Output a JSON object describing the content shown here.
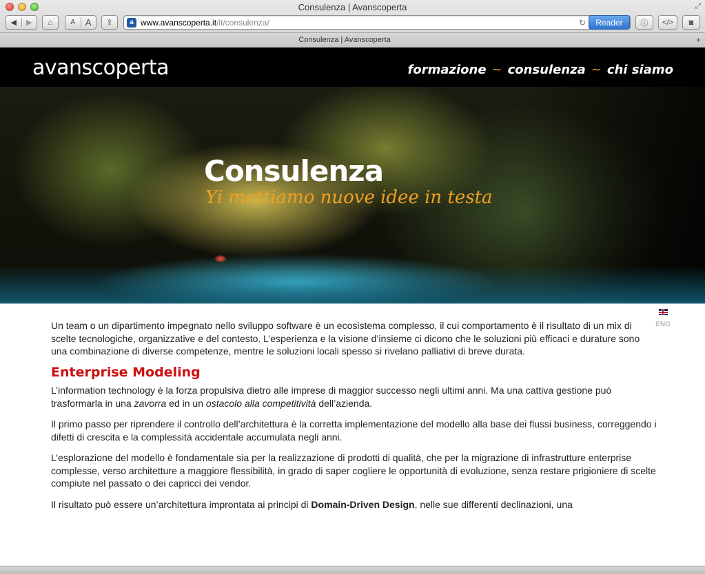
{
  "window": {
    "title": "Consulenza | Avanscoperta"
  },
  "toolbar": {
    "back_icon": "chevron-left",
    "forward_icon": "chevron-right",
    "home_icon": "home",
    "font_small": "A",
    "font_large": "A",
    "share_icon": "share",
    "url_host": "www.avanscoperta.it",
    "url_path": "/it/consulenza/",
    "reader_label": "Reader"
  },
  "tab": {
    "title": "Consulenza | Avanscoperta"
  },
  "site": {
    "logo": "avanscoperta",
    "nav": {
      "formazione": "formazione",
      "consulenza": "consulenza",
      "chi_siamo": "chi siamo",
      "separator": "~"
    },
    "hero": {
      "title": "Consulenza",
      "subtitle": "Yi mettiamo nuove idee in testa"
    },
    "lang_label": "ENG"
  },
  "content": {
    "intro": "Un team o un dipartimento impegnato nello sviluppo software è un ecosistema complesso, il cui comportamento è il risultato di un mix di scelte tecnologiche, organizzative e del contesto. L’esperienza e la visione d’insieme ci dicono che le soluzioni più efficaci e durature sono una combinazione di diverse competenze, mentre le soluzioni locali spesso si rivelano palliativi di breve durata.",
    "heading": "Enterprise Modeling",
    "p1_a": "L’information technology è la forza propulsiva dietro alle imprese di maggior successo negli ultimi anni. Ma una cattiva gestione può trasformarla in una ",
    "p1_em1": "zavorra",
    "p1_b": " ed in un ",
    "p1_em2": "ostacolo alla competitività",
    "p1_c": " dell’azienda.",
    "p2": "Il primo passo per riprendere il controllo dell’architettura è la corretta implementazione del modello alla base dei flussi business, correggendo i difetti di crescita e la complessità accidentale accumulata negli anni.",
    "p3": "L’esplorazione del modello è fondamentale sia per la realizzazione di prodotti di qualità, che per la migrazione di infrastrutture enterprise complesse, verso architetture a maggiore flessibilità, in grado di saper cogliere le opportunità di evoluzione, senza restare prigioniere di scelte compiute nel passato o dei capricci dei vendor.",
    "p4_a": "Il risultato può essere un’architettura improntata ai principi di ",
    "p4_strong": "Domain-Driven Design",
    "p4_b": ", nelle sue differenti declinazioni, una"
  }
}
